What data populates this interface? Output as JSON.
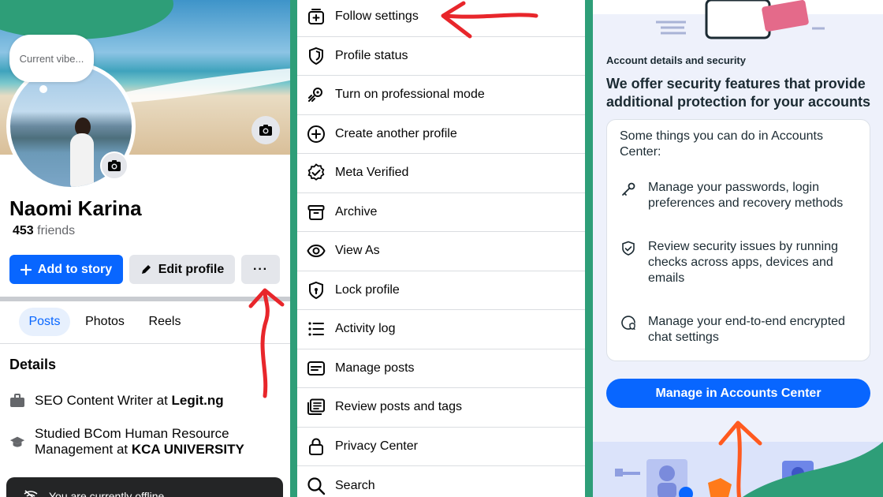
{
  "profile": {
    "status_bubble": "Current vibe...",
    "name": "Naomi Karina",
    "friends_count": "453",
    "friends_label": "friends",
    "add_story_label": "Add to story",
    "edit_profile_label": "Edit profile",
    "more_label": "···",
    "tabs": [
      {
        "label": "Posts",
        "active": true
      },
      {
        "label": "Photos",
        "active": false
      },
      {
        "label": "Reels",
        "active": false
      }
    ],
    "details_title": "Details",
    "details": [
      {
        "icon": "briefcase-icon",
        "text": "SEO Content Writer at ",
        "bold": "Legit.ng"
      },
      {
        "icon": "graduation-cap-icon",
        "text": "Studied BCom Human Resource Management at ",
        "bold": "KCA UNIVERSITY"
      }
    ],
    "toast_text": "You are currently offline"
  },
  "menu": {
    "items": [
      {
        "label": "Follow settings",
        "icon": "follow-settings-icon"
      },
      {
        "label": "Profile status",
        "icon": "shield-icon"
      },
      {
        "label": "Turn on professional mode",
        "icon": "professional-mode-icon"
      },
      {
        "label": "Create another profile",
        "icon": "plus-circle-icon"
      },
      {
        "label": "Meta Verified",
        "icon": "verified-badge-icon"
      },
      {
        "label": "Archive",
        "icon": "archive-icon"
      },
      {
        "label": "View As",
        "icon": "eye-icon"
      },
      {
        "label": "Lock profile",
        "icon": "lock-shield-icon"
      },
      {
        "label": "Activity log",
        "icon": "list-icon"
      },
      {
        "label": "Manage posts",
        "icon": "manage-posts-icon"
      },
      {
        "label": "Review posts and tags",
        "icon": "review-posts-icon"
      },
      {
        "label": "Privacy Center",
        "icon": "padlock-icon"
      },
      {
        "label": "Search",
        "icon": "search-icon"
      }
    ]
  },
  "accounts": {
    "section_label": "Account details and security",
    "title": "We offer security features that provide additional protection for your accounts",
    "card_intro": "Some things you can do in Accounts Center:",
    "features": [
      {
        "icon": "key-icon",
        "text": "Manage your passwords, login preferences and recovery methods"
      },
      {
        "icon": "shield-check-icon",
        "text": "Review security issues by running checks across apps, devices and emails"
      },
      {
        "icon": "encrypted-chat-icon",
        "text": "Manage your end-to-end encrypted chat settings"
      }
    ],
    "cta_label": "Manage in Accounts Center"
  },
  "colors": {
    "accent_blue": "#0866ff",
    "divider_green": "#2e9e78",
    "annotation_red": "#e8262b",
    "annotation_orange": "#ff5a1f"
  }
}
